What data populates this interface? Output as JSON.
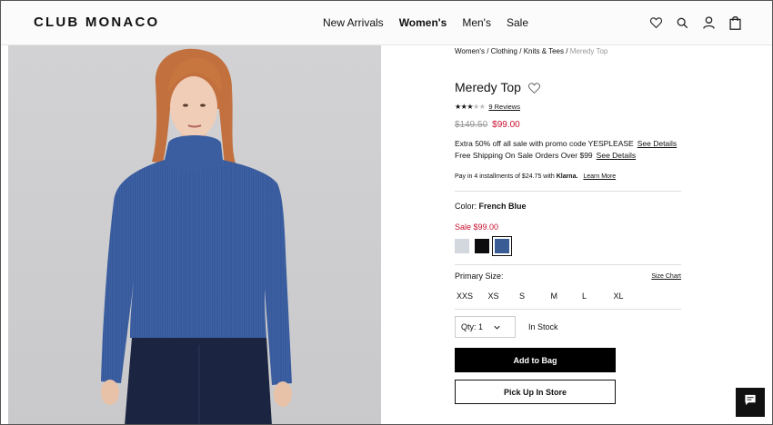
{
  "brand": "CLUB MONACO",
  "nav": {
    "items": [
      {
        "label": "New Arrivals",
        "active": false
      },
      {
        "label": "Women's",
        "active": true
      },
      {
        "label": "Men's",
        "active": false
      },
      {
        "label": "Sale",
        "active": false
      }
    ],
    "icons": [
      "heart-icon",
      "search-icon",
      "account-icon",
      "bag-icon"
    ]
  },
  "breadcrumb": {
    "items": [
      "Women's",
      "Clothing",
      "Knits & Tees"
    ],
    "current": "Meredy Top",
    "separator": "/"
  },
  "product": {
    "title": "Meredy Top",
    "rating": 3,
    "rating_max": 5,
    "reviews_label": "9 Reviews",
    "original_price": "$149.50",
    "sale_price": "$99.00",
    "promo_line1": "Extra 50% off all sale with promo code YESPLEASE",
    "promo_line1_link": "See Details",
    "promo_line2": "Free Shipping On Sale Orders Over $99",
    "promo_line2_link": "See Details",
    "klarna_prefix": "Pay in 4 installments of $24.75 with",
    "klarna_brand": "Klarna.",
    "klarna_link": "Learn More",
    "color_label": "Color:",
    "color_value": "French Blue",
    "color_sale_label": "Sale $99.00",
    "swatches": [
      {
        "name": "light-grey",
        "color": "#d3d8df",
        "selected": false
      },
      {
        "name": "black",
        "color": "#0c0c0e",
        "selected": false
      },
      {
        "name": "french-blue",
        "color": "#3a5c95",
        "selected": true
      }
    ],
    "size_label": "Primary Size:",
    "size_chart_label": "Size Chart",
    "sizes": [
      "XXS",
      "XS",
      "S",
      "M",
      "L",
      "XL"
    ],
    "qty_label": "Qty: 1",
    "stock_label": "In Stock",
    "add_to_bag": "Add to Bag",
    "pick_up": "Pick Up In Store"
  },
  "colors": {
    "sale_red": "#c8102e",
    "button_black": "#000000",
    "image_bg": "#cfcfd1",
    "sweater_blue": "#3f63a5"
  }
}
